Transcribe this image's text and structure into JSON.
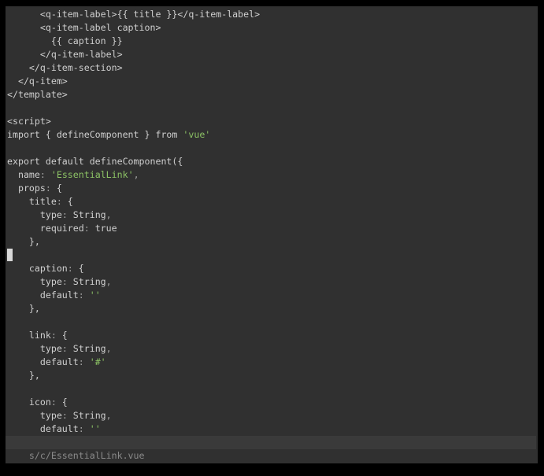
{
  "editor": {
    "cursor_line": 18,
    "colors": {
      "background": "#303030",
      "text": "#cfcfcf",
      "string": "#8cc265",
      "statusbar": "#3a3a3a"
    },
    "lines": [
      [
        [
          "      <q-item-label>{{ title }}</q-item-label>",
          "plain"
        ]
      ],
      [
        [
          "      <q-item-label caption>",
          "plain"
        ]
      ],
      [
        [
          "        {{ caption }}",
          "plain"
        ]
      ],
      [
        [
          "      </q-item-label>",
          "plain"
        ]
      ],
      [
        [
          "    </q-item-section>",
          "plain"
        ]
      ],
      [
        [
          "  </q-item>",
          "plain"
        ]
      ],
      [
        [
          "</template>",
          "plain"
        ]
      ],
      [],
      [
        [
          "<script>",
          "plain"
        ]
      ],
      [
        [
          "import { defineComponent } from ",
          "plain"
        ],
        [
          "'vue'",
          "str"
        ]
      ],
      [],
      [
        [
          "export default defineComponent({",
          "plain"
        ]
      ],
      [
        [
          "  name",
          ""
        ],
        [
          ":",
          "punct"
        ],
        [
          " ",
          "plain"
        ],
        [
          "'EssentialLink'",
          "str"
        ],
        [
          ",",
          "punct"
        ]
      ],
      [
        [
          "  props",
          ""
        ],
        [
          ":",
          "punct"
        ],
        [
          " {",
          "plain"
        ]
      ],
      [
        [
          "    title",
          ""
        ],
        [
          ":",
          "punct"
        ],
        [
          " {",
          "plain"
        ]
      ],
      [
        [
          "      type",
          ""
        ],
        [
          ":",
          "punct"
        ],
        [
          " String",
          "plain"
        ],
        [
          ",",
          "punct"
        ]
      ],
      [
        [
          "      required",
          ""
        ],
        [
          ":",
          "punct"
        ],
        [
          " true",
          "plain"
        ]
      ],
      [
        [
          "    },",
          "plain"
        ]
      ],
      [],
      [
        [
          "    caption",
          ""
        ],
        [
          ":",
          "punct"
        ],
        [
          " {",
          "plain"
        ]
      ],
      [
        [
          "      type",
          ""
        ],
        [
          ":",
          "punct"
        ],
        [
          " String",
          "plain"
        ],
        [
          ",",
          "punct"
        ]
      ],
      [
        [
          "      default",
          ""
        ],
        [
          ":",
          "punct"
        ],
        [
          " ",
          "plain"
        ],
        [
          "''",
          "str"
        ]
      ],
      [
        [
          "    },",
          "plain"
        ]
      ],
      [],
      [
        [
          "    link",
          ""
        ],
        [
          ":",
          "punct"
        ],
        [
          " {",
          "plain"
        ]
      ],
      [
        [
          "      type",
          ""
        ],
        [
          ":",
          "punct"
        ],
        [
          " String",
          "plain"
        ],
        [
          ",",
          "punct"
        ]
      ],
      [
        [
          "      default",
          ""
        ],
        [
          ":",
          "punct"
        ],
        [
          " ",
          "plain"
        ],
        [
          "'#'",
          "str"
        ]
      ],
      [
        [
          "    },",
          "plain"
        ]
      ],
      [],
      [
        [
          "    icon",
          ""
        ],
        [
          ":",
          "punct"
        ],
        [
          " {",
          "plain"
        ]
      ],
      [
        [
          "      type",
          ""
        ],
        [
          ":",
          "punct"
        ],
        [
          " String",
          "plain"
        ],
        [
          ",",
          "punct"
        ]
      ],
      [
        [
          "      default",
          ""
        ],
        [
          ":",
          "punct"
        ],
        [
          " ",
          "plain"
        ],
        [
          "''",
          "str"
        ]
      ]
    ]
  },
  "statusbar": {
    "file_path": "s/c/EssentialLink.vue"
  }
}
